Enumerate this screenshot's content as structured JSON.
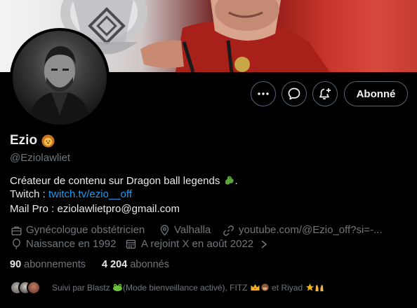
{
  "profile": {
    "name": "Ezio",
    "name_emoji": "lion",
    "handle": "@Eziolawliet",
    "bio_line1": "Créateur de contenu sur Dragon ball legends",
    "bio_line1_emoji": "dragon",
    "bio_line1_end": ".",
    "bio_twitch_label": "Twitch : ",
    "bio_twitch_link": "twitch.tv/ezio__off",
    "bio_mail": "Mail Pro : eziolawlietpro@gmail.com"
  },
  "buttons": {
    "more_icon": "more-horizontal-icon",
    "message_icon": "message-bubble-icon",
    "notify_icon": "bell-plus-icon",
    "follow_label": "Abonné"
  },
  "meta": {
    "profession": "Gynécologue obstétricien",
    "location": "Valhalla",
    "website": "youtube.com/@Ezio_off?si=-...",
    "birth": "Naissance en 1992",
    "joined": "A rejoint X en août 2022"
  },
  "stats": {
    "following_count": "90",
    "following_label": "abonnements",
    "followers_count": "4 204",
    "followers_label": "abonnés"
  },
  "followed_by": {
    "text_before": "Suivi par Blastz",
    "text_mid1": "(Mode bienveillance activé), FITZ",
    "text_mid2": " et Riyad "
  },
  "colors": {
    "background": "#000000",
    "text": "#e7e9ea",
    "secondary": "#71767b",
    "link": "#1d9bf0",
    "border": "#536471"
  }
}
